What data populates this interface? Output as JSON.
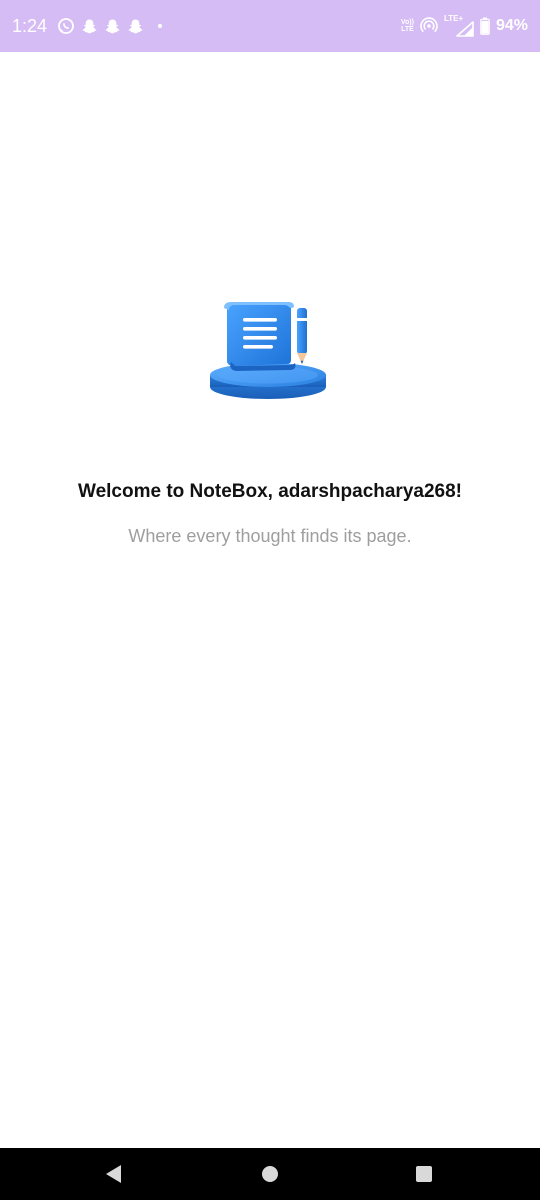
{
  "status_bar": {
    "time": "1:24",
    "icons_left": [
      "whatsapp-icon",
      "snapchat-icon",
      "snapchat-icon",
      "snapchat-icon",
      "notification-dot-icon"
    ],
    "volte_top": "Vo))",
    "volte_bottom": "LTE",
    "lte_label": "LTE+",
    "battery_percent": "94%",
    "battery_level": 0.94
  },
  "main": {
    "illustration": "notes-scroll-pencil-illustration",
    "welcome_title": "Welcome to NoteBox, adarshpacharya268!",
    "subtitle": "Where every thought finds its page."
  },
  "nav_bar": {
    "buttons": [
      "back-icon",
      "home-icon",
      "recents-icon"
    ]
  },
  "colors": {
    "status_bar_bg": "#d6bcf5",
    "title": "#111111",
    "subtitle": "#9e9e9e",
    "accent_blue": "#2f8be6",
    "nav_bar_bg": "#000000"
  }
}
